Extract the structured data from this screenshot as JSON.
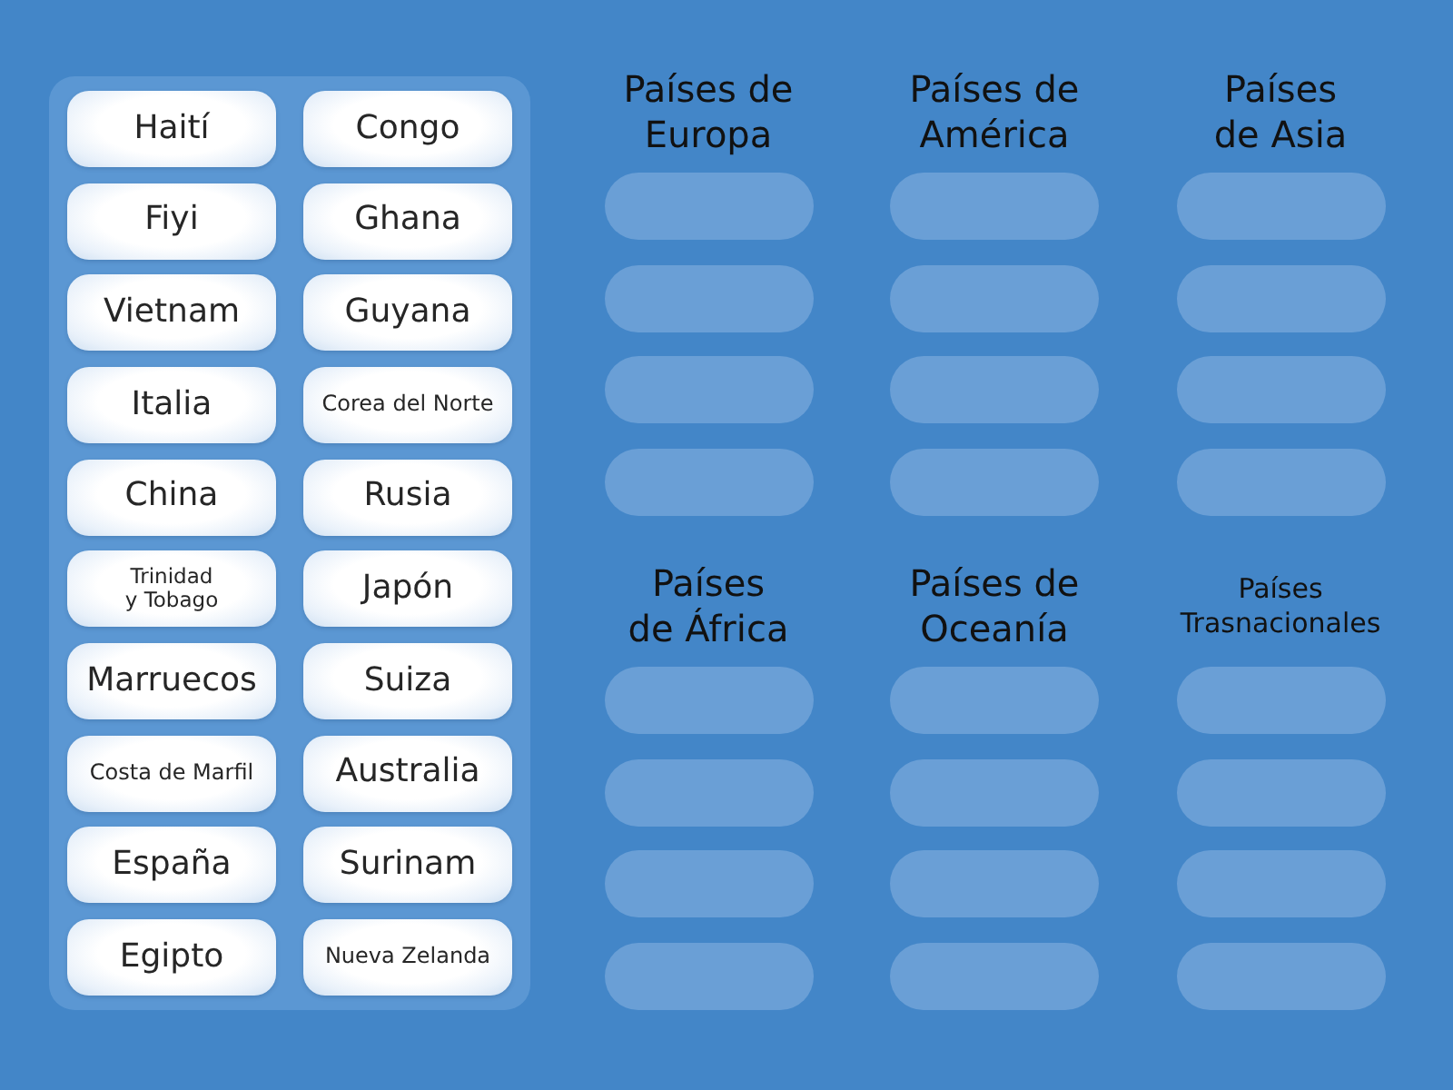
{
  "word_bank": {
    "tiles": [
      "Haití",
      "Congo",
      "Fiyi",
      "Ghana",
      "Vietnam",
      "Guyana",
      "Italia",
      "Corea del Norte",
      "China",
      "Rusia",
      "Trinidad\ny Tobago",
      "Japón",
      "Marruecos",
      "Suiza",
      "Costa de Marfil",
      "Australia",
      "España",
      "Surinam",
      "Egipto",
      "Nueva Zelanda"
    ]
  },
  "categories": [
    {
      "title": "Países de\nEuropa",
      "slots": [
        {
          "kind": "empty"
        },
        {
          "kind": "empty"
        },
        {
          "kind": "empty"
        },
        {
          "kind": "empty"
        }
      ]
    },
    {
      "title": "Países de\nAmérica",
      "slots": [
        {
          "kind": "empty"
        },
        {
          "kind": "empty"
        },
        {
          "kind": "empty"
        },
        {
          "kind": "empty"
        }
      ]
    },
    {
      "title": "Países\nde Asia",
      "slots": [
        {
          "kind": "empty"
        },
        {
          "kind": "empty"
        },
        {
          "kind": "empty"
        },
        {
          "kind": "empty"
        }
      ]
    },
    {
      "title": "Países\nde África",
      "slots": [
        {
          "kind": "empty"
        },
        {
          "kind": "empty"
        },
        {
          "kind": "empty"
        },
        {
          "kind": "empty"
        }
      ]
    },
    {
      "title": "Países de\nOceanía",
      "slots": [
        {
          "kind": "empty"
        },
        {
          "kind": "empty"
        },
        {
          "kind": "empty"
        },
        {
          "kind": "empty"
        }
      ]
    },
    {
      "title": "Países\nTrasnacionales",
      "slots": [
        {
          "kind": "empty"
        },
        {
          "kind": "empty"
        },
        {
          "kind": "empty"
        },
        {
          "kind": "empty"
        }
      ]
    }
  ]
}
